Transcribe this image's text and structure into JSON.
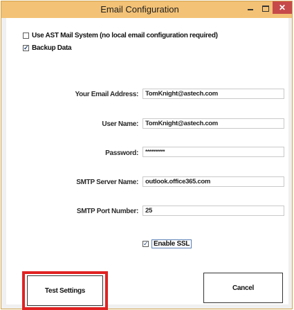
{
  "window": {
    "title": "Email Configuration",
    "close_glyph": "✕"
  },
  "options": {
    "use_ast_mail_label": "Use AST Mail System (no local email configuration required)",
    "use_ast_mail_checked": false,
    "backup_data_label": "Backup Data",
    "backup_data_checked": true
  },
  "form": {
    "email_label": "Your Email Address:",
    "email_value": "TomKnight@astech.com",
    "username_label": "User Name:",
    "username_value": "TomKnight@astech.com",
    "password_label": "Password:",
    "password_value": "**********",
    "smtp_server_label": "SMTP Server Name:",
    "smtp_server_value": "outlook.office365.com",
    "smtp_port_label": "SMTP Port Number:",
    "smtp_port_value": "25",
    "enable_ssl_label": "Enable SSL",
    "enable_ssl_checked": true
  },
  "buttons": {
    "test_settings_label": "Test Settings",
    "cancel_label": "Cancel"
  },
  "colors": {
    "titlebar": "#f3c276",
    "close_button": "#c74a4a",
    "highlight": "#e02222"
  }
}
